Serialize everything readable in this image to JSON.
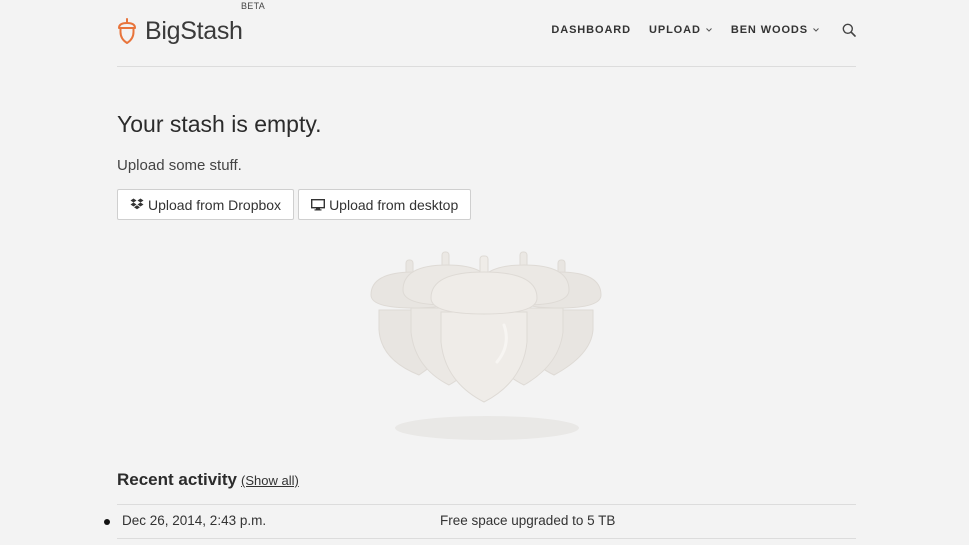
{
  "brand": {
    "name": "BigStash",
    "badge": "BETA",
    "accent_color": "#e8743b"
  },
  "nav": {
    "items": [
      {
        "label": "DASHBOARD",
        "dropdown": false
      },
      {
        "label": "UPLOAD",
        "dropdown": true
      },
      {
        "label": "BEN WOODS",
        "dropdown": true
      }
    ],
    "search_icon": "search-icon"
  },
  "main": {
    "title": "Your stash is empty.",
    "subtitle": "Upload some stuff.",
    "buttons": {
      "dropbox": {
        "label": "Upload from Dropbox",
        "icon": "dropbox-icon"
      },
      "desktop": {
        "label": "Upload from desktop",
        "icon": "monitor-icon"
      }
    },
    "illustration": "acorns-illustration"
  },
  "recent": {
    "title": "Recent activity",
    "show_all": "(Show all)",
    "rows": [
      {
        "date": "Dec 26, 2014, 2:43 p.m.",
        "description": "Free space upgraded to 5 TB"
      }
    ]
  }
}
